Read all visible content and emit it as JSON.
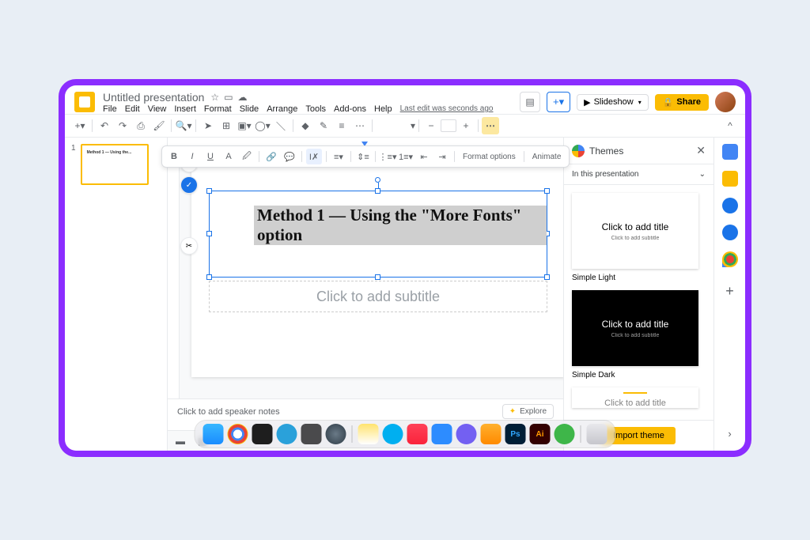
{
  "doc": {
    "title": "Untitled presentation",
    "last_edit": "Last edit was seconds ago"
  },
  "menu": {
    "file": "File",
    "edit": "Edit",
    "view": "View",
    "insert": "Insert",
    "format": "Format",
    "slide": "Slide",
    "arrange": "Arrange",
    "tools": "Tools",
    "addons": "Add-ons",
    "help": "Help"
  },
  "top": {
    "slideshow": "Slideshow",
    "share": "Share"
  },
  "format_bar": {
    "format_options": "Format options",
    "animate": "Animate"
  },
  "slide": {
    "number": "1",
    "title_text": "Method 1 — Using the \"More Fonts\" option",
    "subtitle_placeholder": "Click to add subtitle",
    "thumb_text": "Method 1 — Using the..."
  },
  "notes": {
    "placeholder": "Click to add speaker notes",
    "explore": "Explore"
  },
  "themes": {
    "panel_title": "Themes",
    "section": "In this presentation",
    "light_name": "Simple Light",
    "dark_name": "Simple Dark",
    "card_title": "Click to add title",
    "card_sub": "Click to add subtitle",
    "partial": "Click to add title",
    "import": "Import theme"
  }
}
